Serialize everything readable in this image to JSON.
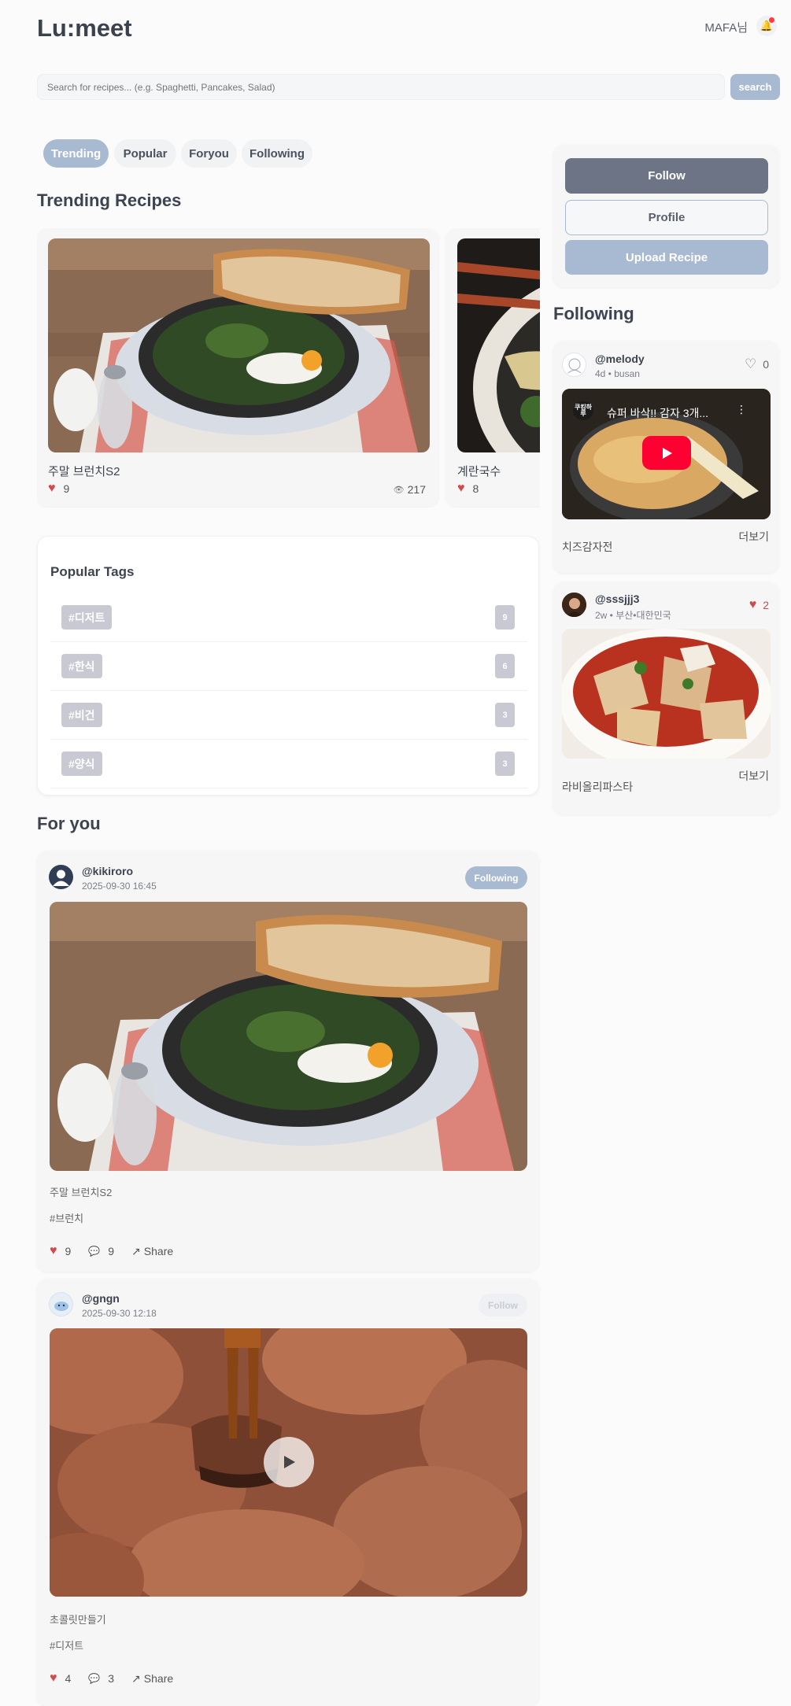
{
  "header": {
    "logo": "Lu:meet",
    "user": "MAFA님",
    "bell_icon": "bell-icon"
  },
  "search": {
    "placeholder": "Search for recipes... (e.g. Spaghetti, Pancakes, Salad)",
    "button": "search"
  },
  "tabs": [
    {
      "label": "Trending"
    },
    {
      "label": "Popular"
    },
    {
      "label": "Foryou"
    },
    {
      "label": "Following"
    }
  ],
  "trending": {
    "title": "Trending Recipes",
    "cards": [
      {
        "name": "주말 브런치S2",
        "likes": "9",
        "views": "217"
      },
      {
        "name": "계란국수",
        "likes": "8"
      }
    ]
  },
  "popular_tags": {
    "title": "Popular Tags",
    "tags": [
      {
        "tag": "#디저트",
        "count": "9"
      },
      {
        "tag": "#한식",
        "count": "6"
      },
      {
        "tag": "#비건",
        "count": "3"
      },
      {
        "tag": "#양식",
        "count": "3"
      }
    ]
  },
  "for_you": {
    "title": "For you",
    "posts": [
      {
        "user": "@kikiroro",
        "time": "2025-09-30 16:45",
        "follow": "Following",
        "name": "주말 브런치S2",
        "tag": "#브런치",
        "likes": "9",
        "comments": "9",
        "share": "Share"
      },
      {
        "user": "@gngn",
        "time": "2025-09-30 12:18",
        "follow": "Follow",
        "name": "초콜릿만들기",
        "tag": "#디저트",
        "likes": "4",
        "comments": "3",
        "share": "Share"
      }
    ]
  },
  "sidebar": {
    "follow": "Follow",
    "profile": "Profile",
    "upload": "Upload Recipe",
    "following_title": "Following",
    "posts": [
      {
        "user": "@melody",
        "meta": "4d • busan",
        "likes": "0",
        "video_title": "슈퍼 바삭!! 감자 3개...",
        "channel": "쿠킹하루",
        "more": "더보기",
        "name": "치즈감자전"
      },
      {
        "user": "@sssjjj3",
        "meta": "2w • 부산•대한민국",
        "likes": "2",
        "more": "더보기",
        "name": "라비올리파스타"
      }
    ]
  },
  "colors": {
    "accent": "#a8bad2",
    "heart": "#d04b4b",
    "dark_button": "#6d7485",
    "youtube": "#ff0033"
  }
}
